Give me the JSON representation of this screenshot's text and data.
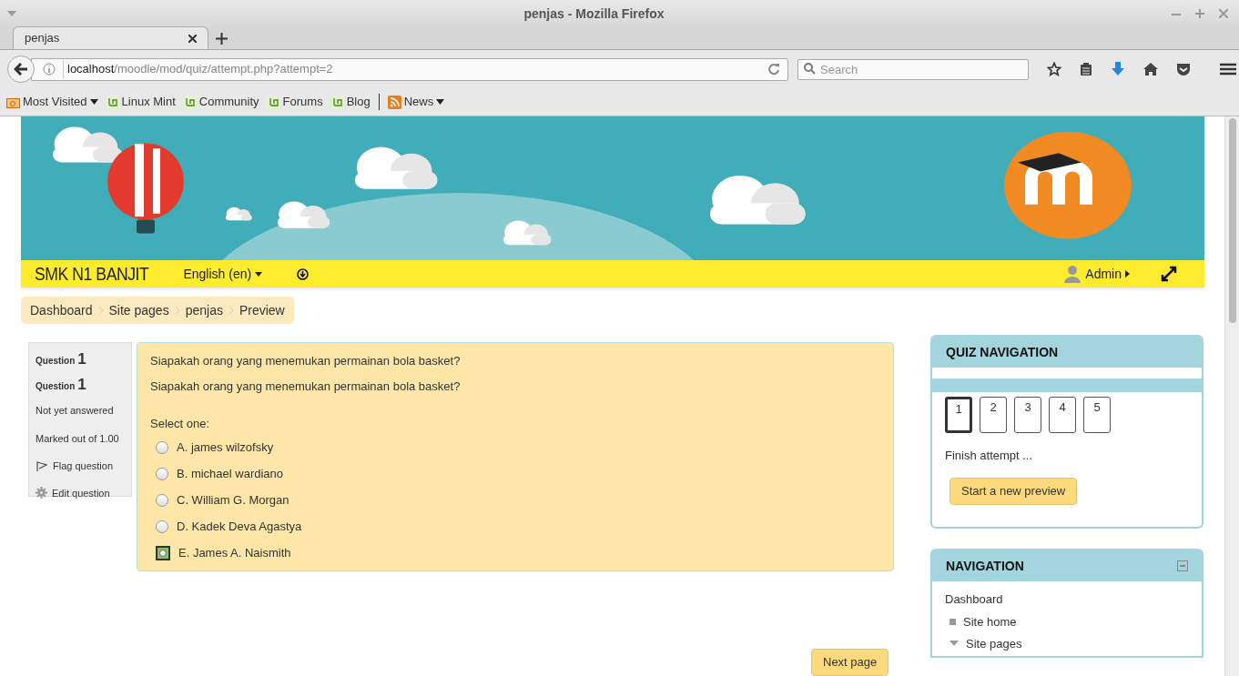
{
  "window": {
    "title": "penjas - Mozilla Firefox"
  },
  "tabs": [
    {
      "label": "penjas",
      "selected": true
    }
  ],
  "address_bar": {
    "host": "localhost",
    "path": "/moodle/mod/quiz/attempt.php?attempt=2"
  },
  "search": {
    "placeholder": "Search"
  },
  "bookmarks": [
    {
      "label": "Most Visited",
      "kind": "folder"
    },
    {
      "label": "Linux Mint",
      "kind": "mint"
    },
    {
      "label": "Community",
      "kind": "mint"
    },
    {
      "label": "Forums",
      "kind": "mint"
    },
    {
      "label": "Blog",
      "kind": "mint"
    },
    {
      "label": "News",
      "kind": "feed"
    }
  ],
  "site": {
    "name": "SMK N1 BANJIT",
    "language": "English (en)",
    "user": "Admin"
  },
  "breadcrumb": [
    "Dashboard",
    "Site pages",
    "penjas",
    "Preview"
  ],
  "question_info": {
    "title_word": "Question",
    "number": "1",
    "title_repeat_word": "Question",
    "number_repeat": "1",
    "status": "Not yet answered",
    "mark": "Marked out of 1.00",
    "flag": "Flag question",
    "edit": "Edit question"
  },
  "question": {
    "text": "Siapakah orang yang menemukan permainan bola basket?",
    "text_repeat": "Siapakah orang yang menemukan permainan bola basket?",
    "prompt": "Select one:",
    "options": [
      {
        "label": "A. james wilzofsky",
        "selected": false
      },
      {
        "label": "B. michael wardiano",
        "selected": false
      },
      {
        "label": "C. William G. Morgan",
        "selected": false
      },
      {
        "label": "D. Kadek Deva Agastya",
        "selected": false
      },
      {
        "label": "E. James A. Naismith",
        "selected": true
      }
    ]
  },
  "next_button": "Next page",
  "quiz_navigation": {
    "title": "QUIZ NAVIGATION",
    "pages": [
      {
        "label": "1",
        "selected": true
      },
      {
        "label": "2",
        "selected": false
      },
      {
        "label": "3",
        "selected": false
      },
      {
        "label": "4",
        "selected": false
      },
      {
        "label": "5",
        "selected": false
      }
    ],
    "finish": "Finish attempt ...",
    "button": "Start a new preview"
  },
  "navigation": {
    "title": "NAVIGATION",
    "items": [
      {
        "label": "Dashboard",
        "kind": "root"
      },
      {
        "label": "Site home",
        "kind": "leaf"
      },
      {
        "label": "Site pages",
        "kind": "branch"
      }
    ]
  }
}
